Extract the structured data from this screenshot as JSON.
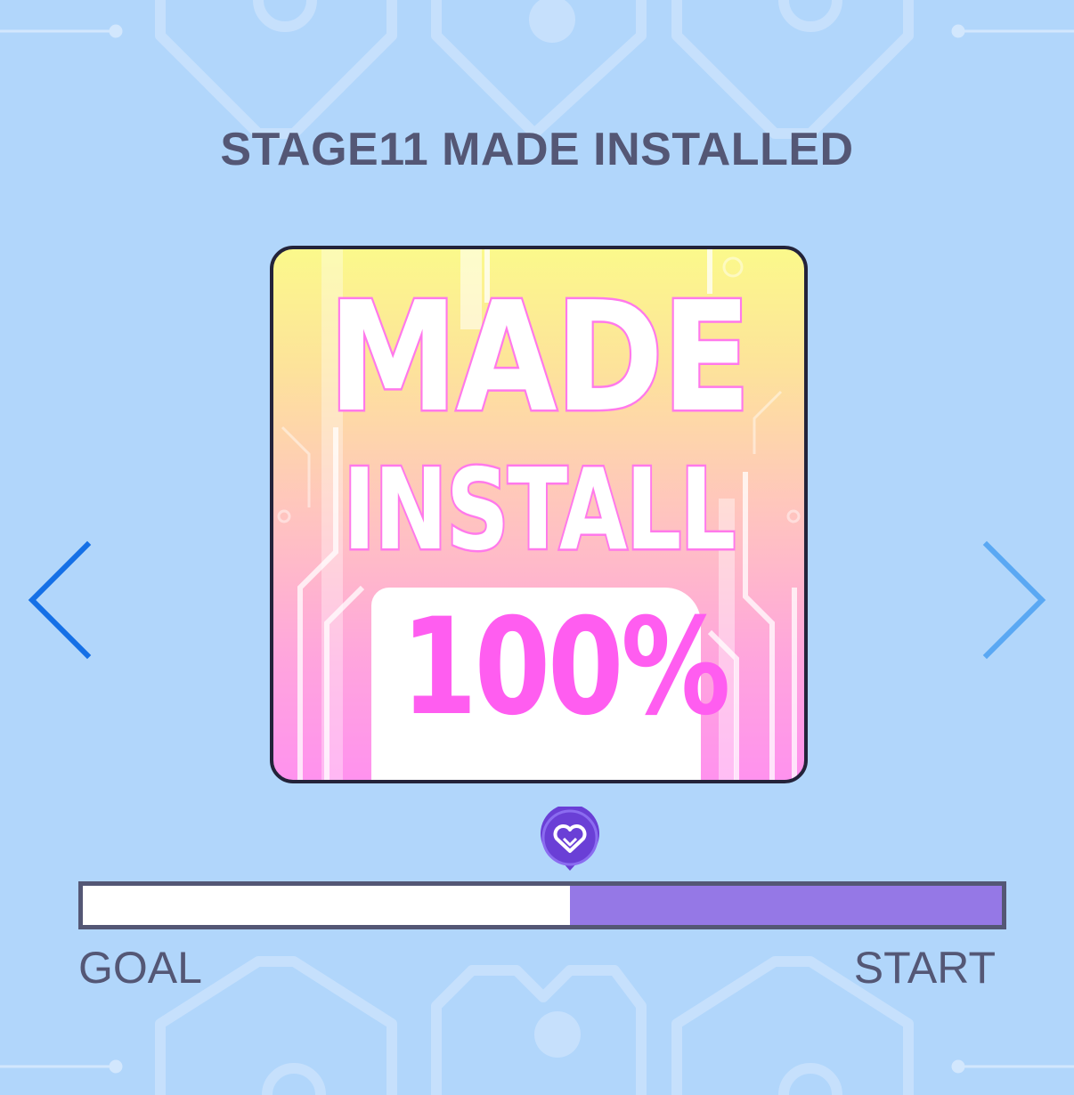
{
  "stage": {
    "title": "STAGE11 MADE INSTALLED"
  },
  "card": {
    "line1": "MADE",
    "line2": "INSTALL",
    "percent": "100%"
  },
  "navigation": {
    "prev_icon": "chevron-left-icon",
    "next_icon": "chevron-right-icon"
  },
  "progress": {
    "fraction_from_goal": 0.53,
    "marker_icon": "heart-icon",
    "left_label": "GOAL",
    "right_label": "START"
  },
  "colors": {
    "background": "#b1d6fb",
    "title_text": "#545775",
    "bar_fill": "#9578e6",
    "bar_remaining": "#ffffff",
    "arrow_active": "#1570e6",
    "arrow_inactive": "#5aa8f3",
    "marker": "#6a3fd6"
  }
}
